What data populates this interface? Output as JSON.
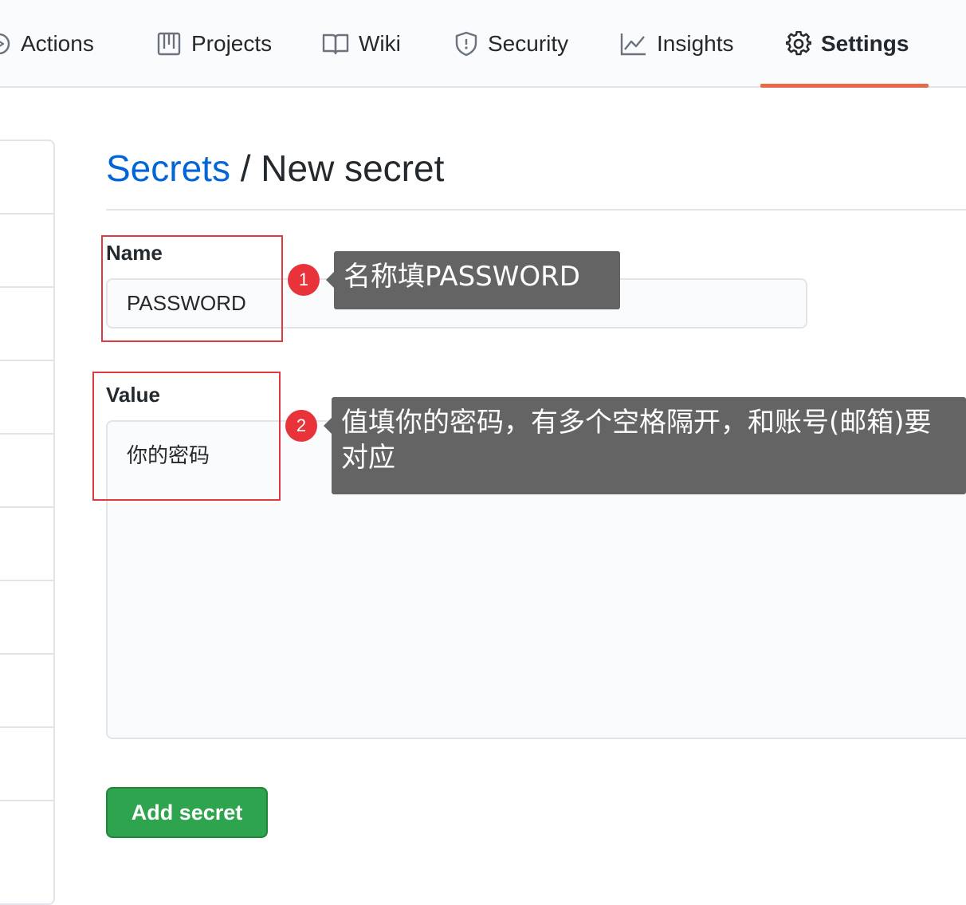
{
  "nav": {
    "tabs": [
      {
        "label": "Actions",
        "icon": "play-icon"
      },
      {
        "label": "Projects",
        "icon": "project-icon"
      },
      {
        "label": "Wiki",
        "icon": "book-icon"
      },
      {
        "label": "Security",
        "icon": "shield-icon"
      },
      {
        "label": "Insights",
        "icon": "graph-icon"
      },
      {
        "label": "Settings",
        "icon": "gear-icon",
        "selected": true
      }
    ],
    "accent_color": "#e46a4a"
  },
  "page": {
    "breadcrumb_link": "Secrets",
    "separator": " / ",
    "title": "New secret"
  },
  "form": {
    "name_label": "Name",
    "name_value": "PASSWORD",
    "value_label": "Value",
    "value_value": "你的密码",
    "submit_label": "Add secret",
    "submit_color": "#2ea44f"
  },
  "annotations": [
    {
      "number": "1",
      "text": "名称填PASSWORD"
    },
    {
      "number": "2",
      "text": "值填你的密码，有多个空格隔开，和账号(邮箱)要对应"
    }
  ]
}
